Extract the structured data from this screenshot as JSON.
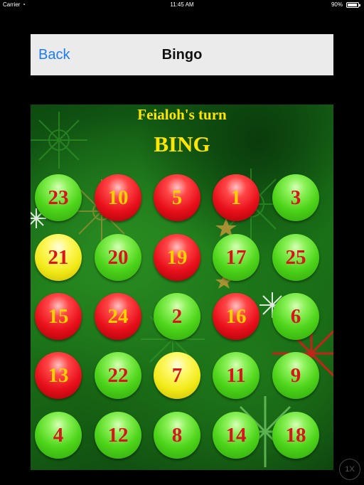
{
  "status_bar": {
    "carrier": "Carrier",
    "time": "11:45 AM",
    "battery": "90%"
  },
  "nav": {
    "back_label": "Back",
    "title": "Bingo"
  },
  "game": {
    "turn_text": "Feialoh's turn",
    "bing_text": "BING",
    "colors": {
      "green": "#4ed41a",
      "red": "#e8101a",
      "yellow": "#f2ea18",
      "text_yellow": "#ffe600",
      "number_red": "#d8141c"
    },
    "board": [
      [
        {
          "n": "23",
          "state": "green"
        },
        {
          "n": "10",
          "state": "red"
        },
        {
          "n": "5",
          "state": "red"
        },
        {
          "n": "1",
          "state": "red"
        },
        {
          "n": "3",
          "state": "green"
        }
      ],
      [
        {
          "n": "21",
          "state": "yellow"
        },
        {
          "n": "20",
          "state": "green"
        },
        {
          "n": "19",
          "state": "red"
        },
        {
          "n": "17",
          "state": "green"
        },
        {
          "n": "25",
          "state": "green"
        }
      ],
      [
        {
          "n": "15",
          "state": "red"
        },
        {
          "n": "24",
          "state": "red"
        },
        {
          "n": "2",
          "state": "green"
        },
        {
          "n": "16",
          "state": "red"
        },
        {
          "n": "6",
          "state": "green"
        }
      ],
      [
        {
          "n": "13",
          "state": "red"
        },
        {
          "n": "22",
          "state": "green"
        },
        {
          "n": "7",
          "state": "yellow"
        },
        {
          "n": "11",
          "state": "green"
        },
        {
          "n": "9",
          "state": "green"
        }
      ],
      [
        {
          "n": "4",
          "state": "green"
        },
        {
          "n": "12",
          "state": "green"
        },
        {
          "n": "8",
          "state": "green"
        },
        {
          "n": "14",
          "state": "green"
        },
        {
          "n": "18",
          "state": "green"
        }
      ]
    ]
  },
  "zoom_button": {
    "label": "1X"
  }
}
